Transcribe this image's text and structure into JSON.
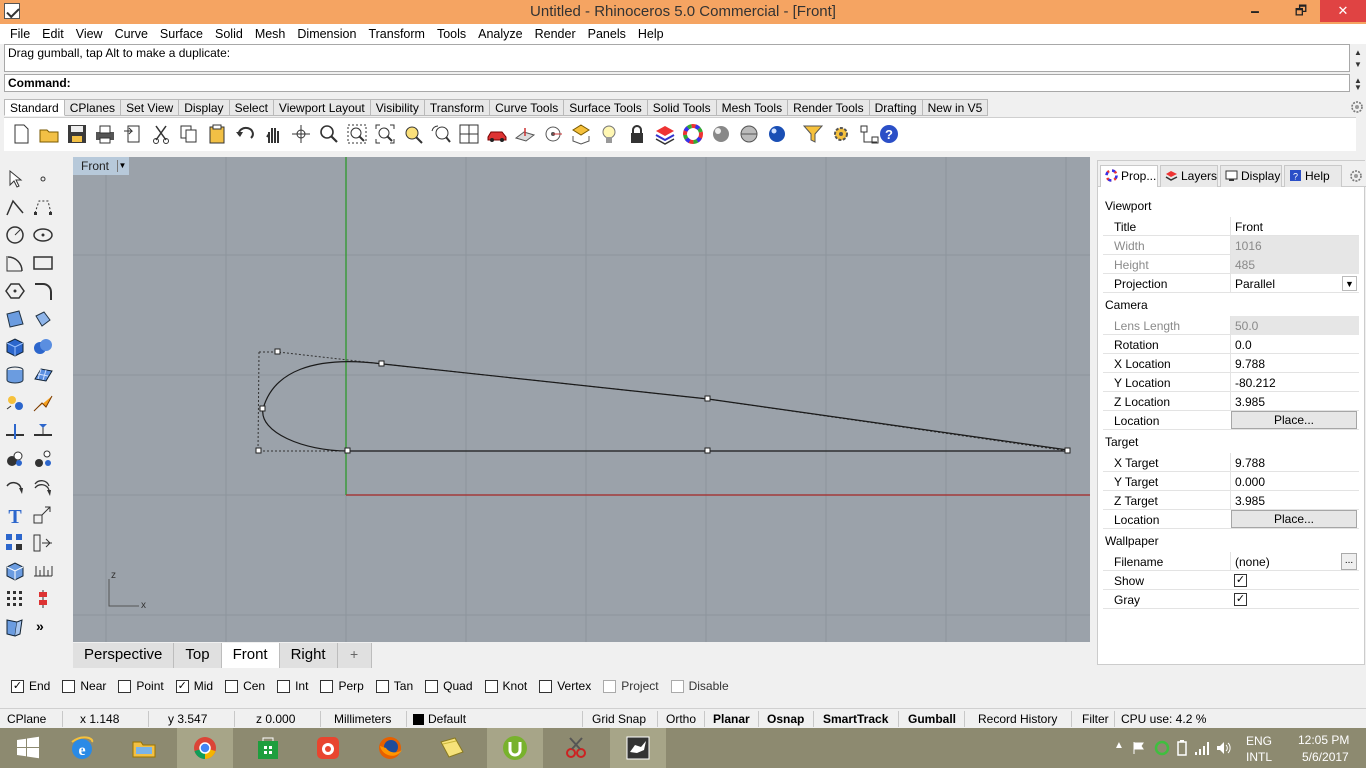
{
  "window": {
    "title": "Untitled - Rhinoceros 5.0 Commercial - [Front]",
    "minimize": "🗕",
    "restore": "🗗",
    "close": "✕"
  },
  "menu": [
    "File",
    "Edit",
    "View",
    "Curve",
    "Surface",
    "Solid",
    "Mesh",
    "Dimension",
    "Transform",
    "Tools",
    "Analyze",
    "Render",
    "Panels",
    "Help"
  ],
  "command": {
    "history": "Drag gumball, tap Alt to make a duplicate:",
    "prompt": "Command:"
  },
  "toolbar_tabs": [
    "Standard",
    "CPlanes",
    "Set View",
    "Display",
    "Select",
    "Viewport Layout",
    "Visibility",
    "Transform",
    "Curve Tools",
    "Surface Tools",
    "Solid Tools",
    "Mesh Tools",
    "Render Tools",
    "Drafting",
    "New in V5"
  ],
  "toolbar_icons": [
    "new-icon",
    "open-icon",
    "save-icon",
    "print-icon",
    "import-icon",
    "cut-icon",
    "copy-icon",
    "paste-icon",
    "undo-icon",
    "pan-icon",
    "rotate-view-icon",
    "zoom-icon",
    "zoom-window-icon",
    "zoom-extents-icon",
    "zoom-selected-icon",
    "undo-view-icon",
    "four-viewports-icon",
    "car-icon",
    "cplane-icon",
    "gumball-icon",
    "grid-snap-icon",
    "light-icon",
    "lock-icon",
    "layer-icon",
    "color-wheel-icon",
    "render-sphere-icon",
    "shaded-sphere-icon",
    "rendered-sphere-icon",
    "blue-sphere-icon",
    "filter-icon",
    "options-icon",
    "osnap-icon",
    "help-icon"
  ],
  "viewport": {
    "label": "Front",
    "axis_z": "z",
    "axis_x": "x"
  },
  "viewport_tabs": [
    "Perspective",
    "Top",
    "Front",
    "Right"
  ],
  "viewport_tab_add": "+",
  "panel": {
    "tabs": [
      "Prop...",
      "Layers",
      "Display",
      "Help"
    ],
    "sections": {
      "viewport": "Viewport",
      "camera": "Camera",
      "target": "Target",
      "wallpaper": "Wallpaper"
    },
    "rows": {
      "title": {
        "label": "Title",
        "value": "Front"
      },
      "width": {
        "label": "Width",
        "value": "1016"
      },
      "height": {
        "label": "Height",
        "value": "485"
      },
      "projection": {
        "label": "Projection",
        "value": "Parallel"
      },
      "lens": {
        "label": "Lens Length",
        "value": "50.0"
      },
      "rotation": {
        "label": "Rotation",
        "value": "0.0"
      },
      "xloc": {
        "label": "X Location",
        "value": "9.788"
      },
      "yloc": {
        "label": "Y Location",
        "value": "-80.212"
      },
      "zloc": {
        "label": "Z Location",
        "value": "3.985"
      },
      "cam_location": {
        "label": "Location",
        "value": "Place..."
      },
      "xtar": {
        "label": "X Target",
        "value": "9.788"
      },
      "ytar": {
        "label": "Y Target",
        "value": "0.000"
      },
      "ztar": {
        "label": "Z Target",
        "value": "3.985"
      },
      "tar_location": {
        "label": "Location",
        "value": "Place..."
      },
      "filename": {
        "label": "Filename",
        "value": "(none)"
      },
      "show": {
        "label": "Show",
        "checked": true
      },
      "gray": {
        "label": "Gray",
        "checked": true
      }
    },
    "browse": "..."
  },
  "osnaps": [
    {
      "label": "End",
      "checked": true
    },
    {
      "label": "Near",
      "checked": false
    },
    {
      "label": "Point",
      "checked": false
    },
    {
      "label": "Mid",
      "checked": true
    },
    {
      "label": "Cen",
      "checked": false
    },
    {
      "label": "Int",
      "checked": false
    },
    {
      "label": "Perp",
      "checked": false
    },
    {
      "label": "Tan",
      "checked": false
    },
    {
      "label": "Quad",
      "checked": false
    },
    {
      "label": "Knot",
      "checked": false
    },
    {
      "label": "Vertex",
      "checked": false
    },
    {
      "label": "Project",
      "checked": false
    },
    {
      "label": "Disable",
      "checked": false
    }
  ],
  "status": {
    "cplane": "CPlane",
    "x": "x 1.148",
    "y": "y 3.547",
    "z": "z 0.000",
    "units": "Millimeters",
    "layer": "Default",
    "grid_snap": "Grid Snap",
    "ortho": "Ortho",
    "planar": "Planar",
    "osnap": "Osnap",
    "smarttrack": "SmartTrack",
    "gumball": "Gumball",
    "record_history": "Record History",
    "filter": "Filter",
    "cpu": "CPU use: 4.2 %"
  },
  "taskbar": {
    "apps": [
      "windows-start-icon",
      "internet-explorer-icon",
      "file-explorer-icon",
      "chrome-icon",
      "store-icon",
      "app-red-icon",
      "firefox-icon",
      "sticky-icon",
      "utorrent-icon",
      "snipping-tool-icon",
      "rhino-icon"
    ],
    "lang_top": "ENG",
    "lang_bottom": "INTL",
    "time": "12:05 PM",
    "date": "5/6/2017"
  },
  "colors": {
    "titlebar": "#f5a462",
    "viewport_bg": "#9ba2aa",
    "grid": "#8d949c",
    "x_axis": "#a33a3a",
    "y_axis": "#3c9a3c"
  }
}
